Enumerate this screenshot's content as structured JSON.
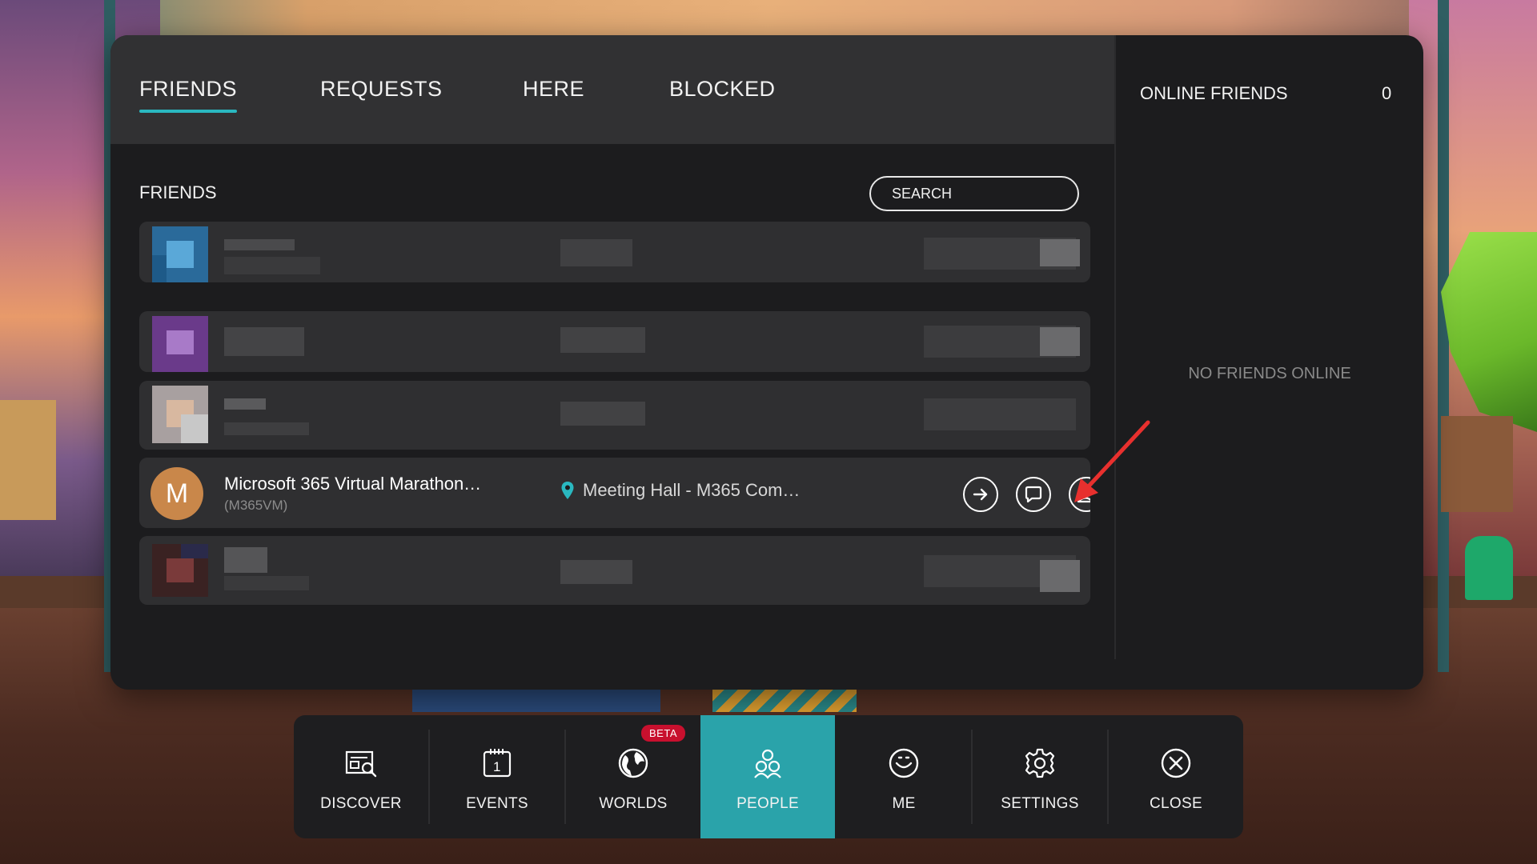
{
  "tabs": [
    {
      "label": "FRIENDS",
      "active": true
    },
    {
      "label": "REQUESTS",
      "active": false
    },
    {
      "label": "HERE",
      "active": false
    },
    {
      "label": "BLOCKED",
      "active": false
    }
  ],
  "friends_section": {
    "title": "FRIENDS",
    "search_placeholder": "SEARCH"
  },
  "friends": [
    {
      "redacted": true,
      "avatar_color": "#3a8ab8"
    },
    {
      "redacted": true,
      "avatar_color": "#8a5aa8"
    },
    {
      "redacted": true,
      "avatar_color": "#c8b0a0"
    },
    {
      "redacted": false,
      "avatar_letter": "M",
      "avatar_color": "#c9874a",
      "name": "Microsoft 365 Virtual Marathon…",
      "handle": "(M365VM)",
      "location": "Meeting Hall - M365 Com…",
      "actions": [
        "join-icon",
        "chat-icon",
        "profile-icon"
      ]
    },
    {
      "redacted": true,
      "avatar_color": "#5a2a2a"
    }
  ],
  "online": {
    "title": "ONLINE FRIENDS",
    "count": "0",
    "empty_text": "NO FRIENDS ONLINE"
  },
  "dock": [
    {
      "label": "DISCOVER",
      "icon": "discover-icon",
      "active": false
    },
    {
      "label": "EVENTS",
      "icon": "calendar-icon",
      "active": false
    },
    {
      "label": "WORLDS",
      "icon": "globe-icon",
      "active": false,
      "badge": "BETA"
    },
    {
      "label": "PEOPLE",
      "icon": "people-icon",
      "active": true
    },
    {
      "label": "ME",
      "icon": "smiley-icon",
      "active": false
    },
    {
      "label": "SETTINGS",
      "icon": "gear-icon",
      "active": false
    },
    {
      "label": "CLOSE",
      "icon": "close-icon",
      "active": false
    }
  ],
  "colors": {
    "accent": "#2aa3aa",
    "tab_underline": "#2ab8c0",
    "beta_badge": "#c8102e",
    "annotation_arrow": "#e8302e"
  }
}
